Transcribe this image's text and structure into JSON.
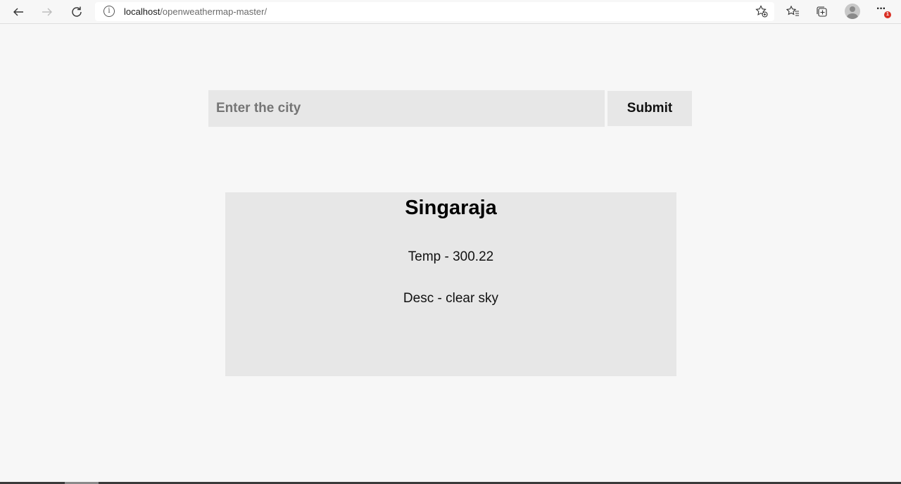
{
  "browser": {
    "url_host": "localhost",
    "url_path": "/openweathermap-master/",
    "notification_count": "1"
  },
  "icons": {
    "back": "back-arrow-icon",
    "forward": "forward-arrow-icon",
    "refresh": "refresh-icon",
    "site_info": "info-icon",
    "add_favorite": "star-add-icon",
    "favorites": "favorites-icon",
    "collections": "collections-icon",
    "profile": "profile-avatar-icon",
    "more": "more-icon"
  },
  "form": {
    "city_placeholder": "Enter the city",
    "city_value": "",
    "submit_label": "Submit"
  },
  "weather": {
    "city": "Singaraja",
    "temp_line": "Temp - 300.22",
    "desc_line": "Desc - clear sky"
  },
  "colors": {
    "page_bg": "#f7f7f7",
    "panel_bg": "#e7e7e7",
    "notification": "#d93025"
  }
}
